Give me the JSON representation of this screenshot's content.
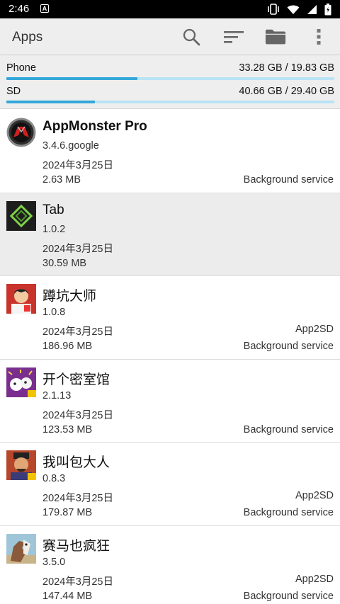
{
  "status_bar": {
    "time": "2:46",
    "notification_letter": "A"
  },
  "toolbar": {
    "title": "Apps",
    "search_icon": "search-icon",
    "sort_icon": "sort-icon",
    "folder_icon": "folder-icon",
    "menu_icon": "more-vert-icon"
  },
  "storage": {
    "phone": {
      "label": "Phone",
      "value": "33.28 GB / 19.83 GB",
      "fill": 0.4
    },
    "sd": {
      "label": "SD",
      "value": "40.66 GB / 29.40 GB",
      "fill": 0.27
    }
  },
  "colors": {
    "accent": "#33a8d9",
    "track": "#b9e3f5",
    "toolbar_bg": "#eeeeee",
    "selected_bg": "#ececec"
  },
  "apps": [
    {
      "name": "AppMonster Pro",
      "version": "3.4.6.google",
      "date": "2024年3月25日",
      "size": "2.63 MB",
      "flag1": "",
      "flag2": "Background service",
      "icon": "appmonster-icon"
    },
    {
      "name": "Tab",
      "version": "1.0.2",
      "date": "2024年3月25日",
      "size": "30.59 MB",
      "flag1": "",
      "flag2": "",
      "icon": "tab-app-icon"
    },
    {
      "name": "蹲坑大师",
      "version": "1.0.8",
      "date": "2024年3月25日",
      "size": "186.96 MB",
      "flag1": "App2SD",
      "flag2": "Background service",
      "icon": "game-icon"
    },
    {
      "name": "开个密室馆",
      "version": "2.1.13",
      "date": "2024年3月25日",
      "size": "123.53 MB",
      "flag1": "",
      "flag2": "Background service",
      "icon": "game-icon"
    },
    {
      "name": "我叫包大人",
      "version": "0.8.3",
      "date": "2024年3月25日",
      "size": "179.87 MB",
      "flag1": "App2SD",
      "flag2": "Background service",
      "icon": "game-icon"
    },
    {
      "name": "赛马也疯狂",
      "version": "3.5.0",
      "date": "2024年3月25日",
      "size": "147.44 MB",
      "flag1": "App2SD",
      "flag2": "Background service",
      "icon": "horse-game-icon"
    }
  ]
}
